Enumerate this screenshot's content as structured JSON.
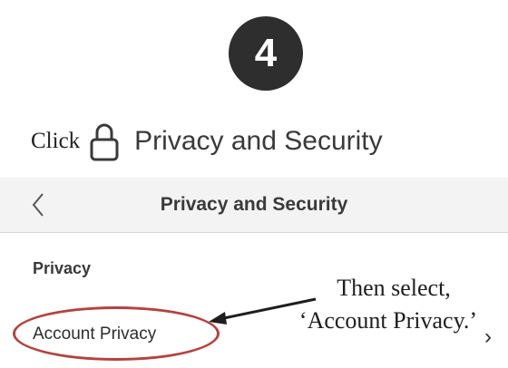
{
  "step": {
    "number": "4"
  },
  "instruction": {
    "prefix": "Click",
    "icon": "lock-icon",
    "setting": "Privacy and Security"
  },
  "nav": {
    "back_icon": "chevron-left-icon",
    "title": "Privacy and Security"
  },
  "section": {
    "header": "Privacy"
  },
  "list": {
    "items": [
      {
        "label": "Account Privacy",
        "chevron": "chevron-right-icon"
      }
    ]
  },
  "annotation": {
    "line1": "Then select,",
    "line2": "‘Account Privacy.’"
  },
  "colors": {
    "badge": "#2e2e2e",
    "highlight": "#b6413e",
    "nav_bg": "#f3f3f4"
  }
}
